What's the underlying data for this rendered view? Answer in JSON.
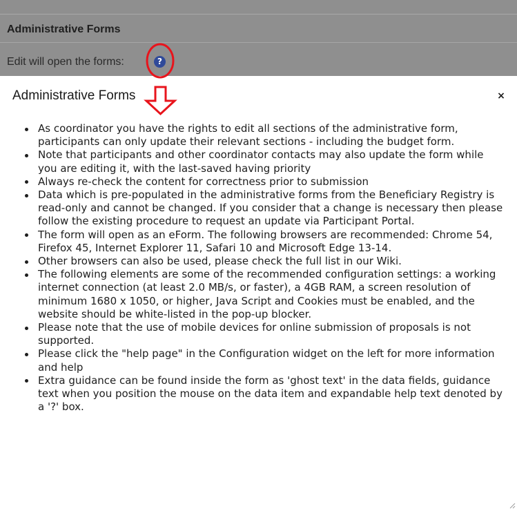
{
  "background": {
    "section_title": "Administrative Forms",
    "edit_text": "Edit will open the forms:",
    "help_icon": "question-circle-icon"
  },
  "dialog": {
    "title": "Administrative Forms",
    "close_label": "×",
    "items": [
      "As coordinator you have the rights to edit all sections of the administrative form, participants can only update their relevant sections - including the budget form.",
      "Note that participants and other coordinator contacts may also update the form while you are editing it, with the last-saved having priority",
      "Always re-check the content for correctness prior to submission",
      "Data which is pre-populated in the administrative forms from the Beneficiary Registry is read-only and cannot be changed. If you consider that a change is necessary then please follow the existing procedure to request an update via Participant Portal.",
      "The form will open as an eForm. The following browsers are recommended: Chrome 54, Firefox 45, Internet Explorer 11, Safari 10 and Microsoft Edge 13-14.",
      "Other browsers can also be used, please check the full list in our Wiki.",
      "The following elements are some of the recommended configuration settings: a working internet connection (at least 2.0 MB/s, or faster), a 4GB RAM, a screen resolution of minimum 1680 x 1050, or higher, Java Script and Cookies must be enabled, and the website should be white-listed in the pop-up blocker.",
      "Please note that the use of mobile devices for online submission of proposals is not supported.",
      "Please click the \"help page\" in the Configuration widget on the left for more information and help",
      "Extra guidance can be found inside the form as 'ghost text' in the data fields, guidance text when you position the mouse on the data item and expandable help text denoted by a '?' box."
    ]
  },
  "colors": {
    "overlay": "#8f8f8f",
    "help_icon": "#2f4a9a",
    "annotation": "#e8141c"
  }
}
